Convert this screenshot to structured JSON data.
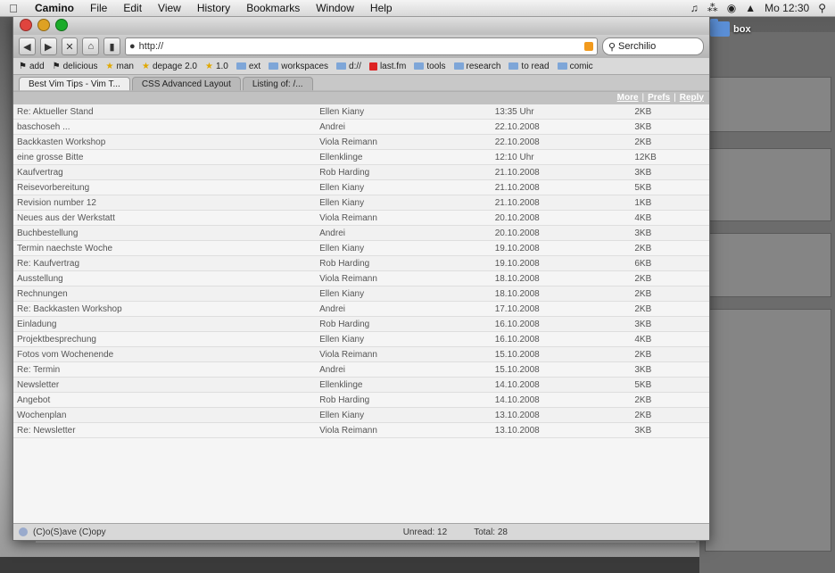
{
  "menubar": {
    "app_name": "Camino",
    "items": [
      "File",
      "Edit",
      "View",
      "History",
      "Bookmarks",
      "Window",
      "Help"
    ],
    "clock": "Mo 12:30"
  },
  "desktop": {
    "folder_label": "box"
  },
  "browser": {
    "url": "http://",
    "search_placeholder": "Serchilio",
    "bookmarks": [
      {
        "label": "add",
        "icon": "bookmark-icon"
      },
      {
        "label": "delicious",
        "icon": "bookmark-icon"
      },
      {
        "label": "man",
        "icon": "star-icon"
      },
      {
        "label": "depage 2.0",
        "icon": "star-icon"
      },
      {
        "label": "1.0",
        "icon": "star-icon"
      },
      {
        "label": "ext",
        "icon": "folder-icon"
      },
      {
        "label": "workspaces",
        "icon": "folder-icon"
      },
      {
        "label": "d://",
        "icon": "folder-icon"
      },
      {
        "label": "last.fm",
        "icon": "lastfm-icon"
      },
      {
        "label": "tools",
        "icon": "folder-icon"
      },
      {
        "label": "research",
        "icon": "folder-icon"
      },
      {
        "label": "to read",
        "icon": "folder-icon"
      },
      {
        "label": "comic",
        "icon": "folder-icon"
      }
    ],
    "tabs": [
      {
        "label": "Best Vim Tips - Vim T..."
      },
      {
        "label": "CSS Advanced Layout"
      },
      {
        "label": "Listing of: /..."
      }
    ],
    "header_links": [
      "More",
      "Prefs",
      "Reply"
    ],
    "inbox_rows": [
      [
        "Re: Aktueller Stand",
        "Ellen Kiany",
        "13:35 Uhr",
        "2KB"
      ],
      [
        "baschoseh ...",
        "Andrei",
        "22.10.2008",
        "3KB"
      ],
      [
        "Backkasten Workshop",
        "Viola Reimann",
        "22.10.2008",
        "2KB"
      ],
      [
        "eine grosse Bitte",
        "Ellenklinge",
        "12:10 Uhr",
        "12KB"
      ],
      [
        "Kaufvertrag",
        "Rob Harding",
        "21.10.2008",
        "3KB"
      ],
      [
        "Reisevorbereitung",
        "Ellen Kiany",
        "21.10.2008",
        "5KB"
      ],
      [
        "Revision number 12",
        "Ellen Kiany",
        "21.10.2008",
        "1KB"
      ],
      [
        "Neues aus der Werkstatt",
        "Viola Reimann",
        "20.10.2008",
        "4KB"
      ],
      [
        "Buchbestellung",
        "Andrei",
        "20.10.2008",
        "3KB"
      ],
      [
        "Termin naechste Woche",
        "Ellen Kiany",
        "19.10.2008",
        "2KB"
      ],
      [
        "Re: Kaufvertrag",
        "Rob Harding",
        "19.10.2008",
        "6KB"
      ],
      [
        "Ausstellung",
        "Viola Reimann",
        "18.10.2008",
        "2KB"
      ],
      [
        "Rechnungen",
        "Ellen Kiany",
        "18.10.2008",
        "2KB"
      ],
      [
        "Re: Backkasten Workshop",
        "Andrei",
        "17.10.2008",
        "2KB"
      ],
      [
        "Einladung",
        "Rob Harding",
        "16.10.2008",
        "3KB"
      ],
      [
        "Projektbesprechung",
        "Ellen Kiany",
        "16.10.2008",
        "4KB"
      ],
      [
        "Fotos vom Wochenende",
        "Viola Reimann",
        "15.10.2008",
        "2KB"
      ],
      [
        "Re: Termin",
        "Andrei",
        "15.10.2008",
        "3KB"
      ],
      [
        "Newsletter",
        "Ellenklinge",
        "14.10.2008",
        "5KB"
      ],
      [
        "Angebot",
        "Rob Harding",
        "14.10.2008",
        "2KB"
      ],
      [
        "Wochenplan",
        "Ellen Kiany",
        "13.10.2008",
        "2KB"
      ],
      [
        "Re: Newsletter",
        "Viola Reimann",
        "13.10.2008",
        "3KB"
      ]
    ],
    "status": {
      "left": "(C)o(S)ave (C)opy",
      "unread": "Unread: 12",
      "total": "Total: 28"
    }
  }
}
